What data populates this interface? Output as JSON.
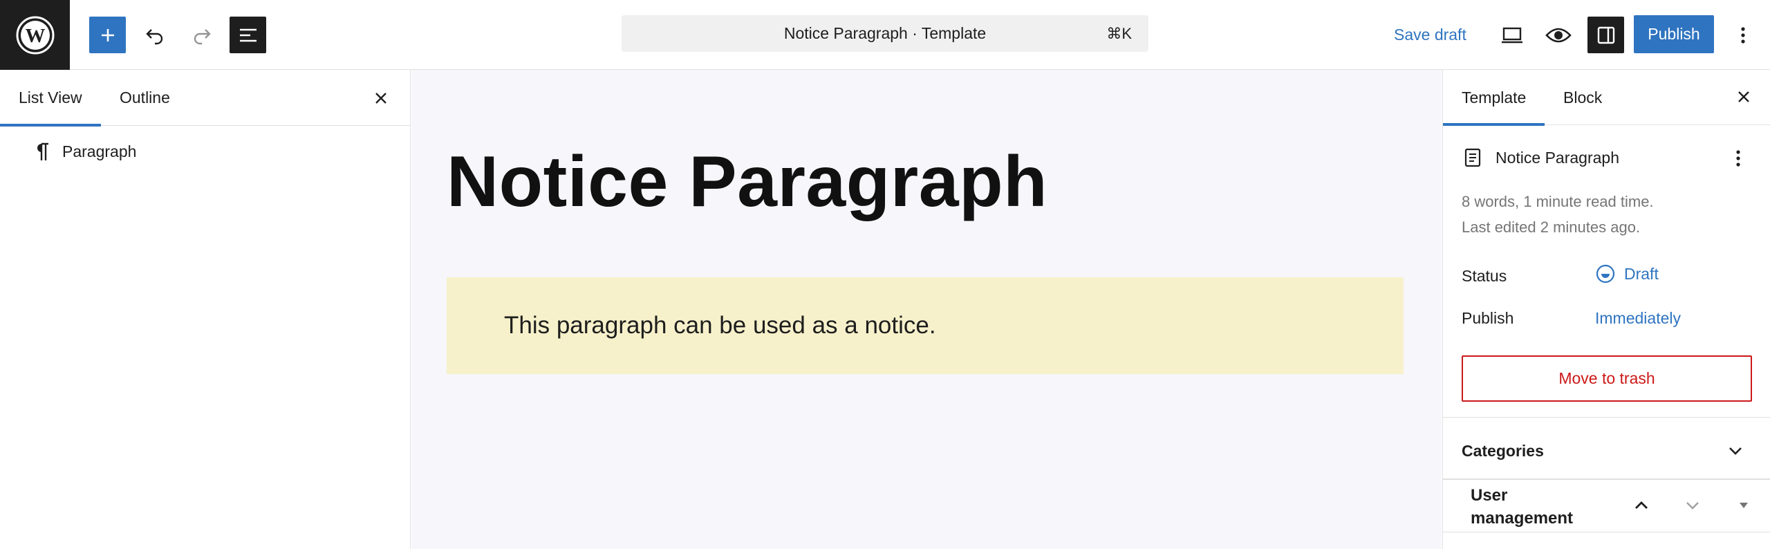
{
  "topbar": {
    "command_title": "Notice Paragraph · Template",
    "command_shortcut": "⌘K",
    "save_draft_label": "Save draft",
    "publish_label": "Publish",
    "icons": [
      "wordpress-icon",
      "plus-icon",
      "undo-icon",
      "redo-icon",
      "list-view-icon",
      "desktop-icon",
      "preview-icon",
      "sidebar-icon",
      "more-vertical-icon"
    ]
  },
  "left_panel": {
    "tabs": [
      {
        "label": "List View",
        "active": true
      },
      {
        "label": "Outline",
        "active": false
      }
    ],
    "items": [
      {
        "label": "Paragraph",
        "icon": "paragraph-icon"
      }
    ]
  },
  "canvas": {
    "title": "Notice Paragraph",
    "notice_text": "This paragraph can be used as a notice.",
    "notice_bg": "#f7f1cb",
    "canvas_bg": "#f6f6fb"
  },
  "right_panel": {
    "tabs": [
      {
        "label": "Template",
        "active": true
      },
      {
        "label": "Block",
        "active": false
      }
    ],
    "doc_title": "Notice Paragraph",
    "words_meta": "8 words, 1 minute read time.",
    "edited_meta": "Last edited 2 minutes ago.",
    "status_label": "Status",
    "status_value": "Draft",
    "publish_label": "Publish",
    "publish_value": "Immediately",
    "trash_label": "Move to trash",
    "categories_label": "Categories",
    "user_management_label": "User management"
  },
  "colors": {
    "accent": "#2f74c0",
    "danger": "#cc1818",
    "dark": "#1e1e1e",
    "muted": "#757575"
  }
}
